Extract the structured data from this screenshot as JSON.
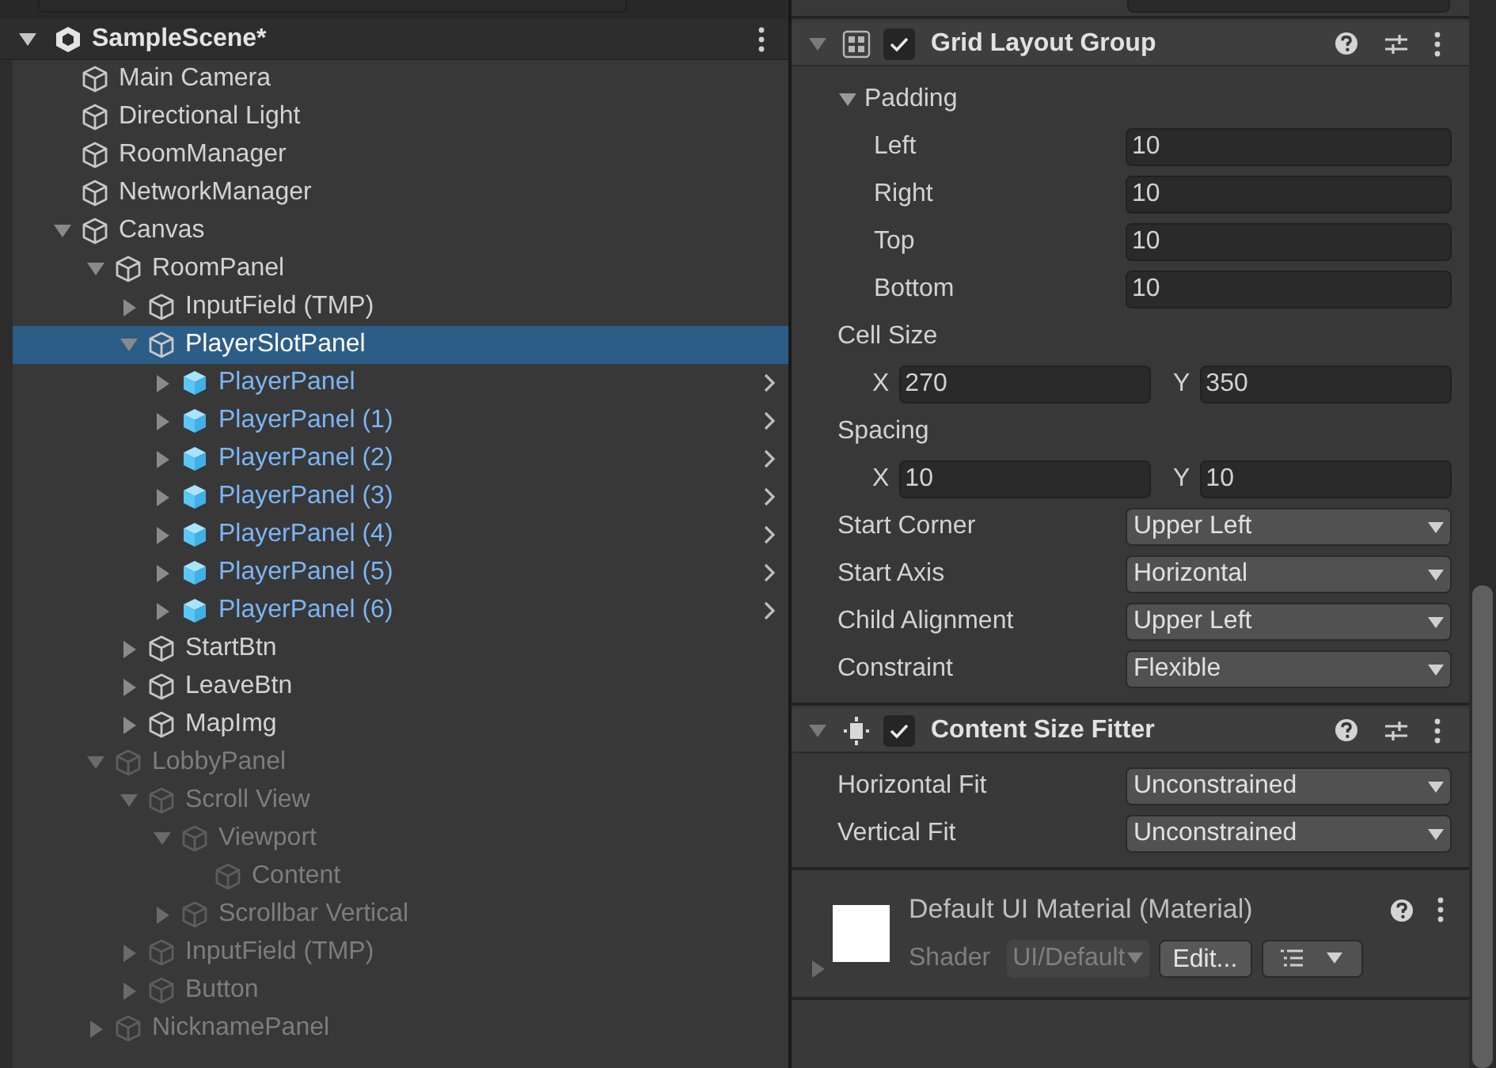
{
  "hierarchy": {
    "scene": {
      "title": "SampleScene*",
      "expanded": true
    },
    "items": [
      {
        "name": "Main Camera",
        "kind": "object",
        "selected": false,
        "disabled": false
      },
      {
        "name": "Directional Light",
        "kind": "object",
        "selected": false,
        "disabled": false
      },
      {
        "name": "RoomManager",
        "kind": "object",
        "selected": false,
        "disabled": false
      },
      {
        "name": "NetworkManager",
        "kind": "object",
        "selected": false,
        "disabled": false
      },
      {
        "name": "Canvas",
        "kind": "object",
        "selected": false,
        "disabled": false,
        "expanded": true,
        "children": [
          {
            "name": "RoomPanel",
            "kind": "object",
            "selected": false,
            "disabled": false,
            "expanded": true,
            "children": [
              {
                "name": "InputField (TMP)",
                "kind": "object",
                "selected": false,
                "disabled": false,
                "expanded": false
              },
              {
                "name": "PlayerSlotPanel",
                "kind": "object",
                "selected": true,
                "disabled": false,
                "expanded": true,
                "children": [
                  {
                    "name": "PlayerPanel",
                    "kind": "prefab",
                    "selected": false,
                    "disabled": false,
                    "expanded": false
                  },
                  {
                    "name": "PlayerPanel (1)",
                    "kind": "prefab",
                    "selected": false,
                    "disabled": false,
                    "expanded": false
                  },
                  {
                    "name": "PlayerPanel (2)",
                    "kind": "prefab",
                    "selected": false,
                    "disabled": false,
                    "expanded": false
                  },
                  {
                    "name": "PlayerPanel (3)",
                    "kind": "prefab",
                    "selected": false,
                    "disabled": false,
                    "expanded": false
                  },
                  {
                    "name": "PlayerPanel (4)",
                    "kind": "prefab",
                    "selected": false,
                    "disabled": false,
                    "expanded": false
                  },
                  {
                    "name": "PlayerPanel (5)",
                    "kind": "prefab",
                    "selected": false,
                    "disabled": false,
                    "expanded": false
                  },
                  {
                    "name": "PlayerPanel (6)",
                    "kind": "prefab",
                    "selected": false,
                    "disabled": false,
                    "expanded": false
                  }
                ]
              },
              {
                "name": "StartBtn",
                "kind": "object",
                "selected": false,
                "disabled": false,
                "expanded": false
              },
              {
                "name": "LeaveBtn",
                "kind": "object",
                "selected": false,
                "disabled": false,
                "expanded": false
              },
              {
                "name": "MapImg",
                "kind": "object",
                "selected": false,
                "disabled": false,
                "expanded": false
              }
            ]
          },
          {
            "name": "LobbyPanel",
            "kind": "object",
            "selected": false,
            "disabled": true,
            "expanded": true,
            "children": [
              {
                "name": "Scroll View",
                "kind": "object",
                "selected": false,
                "disabled": true,
                "expanded": true,
                "children": [
                  {
                    "name": "Viewport",
                    "kind": "object",
                    "selected": false,
                    "disabled": true,
                    "expanded": true,
                    "children": [
                      {
                        "name": "Content",
                        "kind": "object",
                        "selected": false,
                        "disabled": true
                      }
                    ]
                  },
                  {
                    "name": "Scrollbar Vertical",
                    "kind": "object",
                    "selected": false,
                    "disabled": true,
                    "expanded": false
                  }
                ]
              },
              {
                "name": "InputField (TMP)",
                "kind": "object",
                "selected": false,
                "disabled": true,
                "expanded": false
              },
              {
                "name": "Button",
                "kind": "object",
                "selected": false,
                "disabled": true,
                "expanded": false
              }
            ]
          },
          {
            "name": "NicknamePanel",
            "kind": "object",
            "selected": false,
            "disabled": true,
            "expanded": false
          }
        ]
      }
    ]
  },
  "inspector": {
    "components": [
      {
        "title": "Grid Layout Group",
        "enabled": true,
        "expanded": true,
        "properties": [
          {
            "kind": "foldout",
            "label": "Padding",
            "expanded": true,
            "children": [
              {
                "kind": "field",
                "label": "Left",
                "value": "10"
              },
              {
                "kind": "field",
                "label": "Right",
                "value": "10"
              },
              {
                "kind": "field",
                "label": "Top",
                "value": "10"
              },
              {
                "kind": "field",
                "label": "Bottom",
                "value": "10"
              }
            ]
          },
          {
            "kind": "vector2",
            "label": "Cell Size",
            "axes": [
              {
                "axis": "X",
                "value": "270"
              },
              {
                "axis": "Y",
                "value": "350"
              }
            ]
          },
          {
            "kind": "vector2",
            "label": "Spacing",
            "axes": [
              {
                "axis": "X",
                "value": "10"
              },
              {
                "axis": "Y",
                "value": "10"
              }
            ]
          },
          {
            "kind": "dropdown",
            "label": "Start Corner",
            "value": "Upper Left"
          },
          {
            "kind": "dropdown",
            "label": "Start Axis",
            "value": "Horizontal"
          },
          {
            "kind": "dropdown",
            "label": "Child Alignment",
            "value": "Upper Left"
          },
          {
            "kind": "dropdown",
            "label": "Constraint",
            "value": "Flexible"
          }
        ]
      },
      {
        "title": "Content Size Fitter",
        "enabled": true,
        "expanded": true,
        "properties": [
          {
            "kind": "dropdown",
            "label": "Horizontal Fit",
            "value": "Unconstrained"
          },
          {
            "kind": "dropdown",
            "label": "Vertical Fit",
            "value": "Unconstrained"
          }
        ]
      }
    ],
    "material": {
      "title": "Default UI Material (Material)",
      "shader_label": "Shader",
      "shader_value": "UI/Default",
      "edit_button": "Edit...",
      "expanded": false
    }
  }
}
